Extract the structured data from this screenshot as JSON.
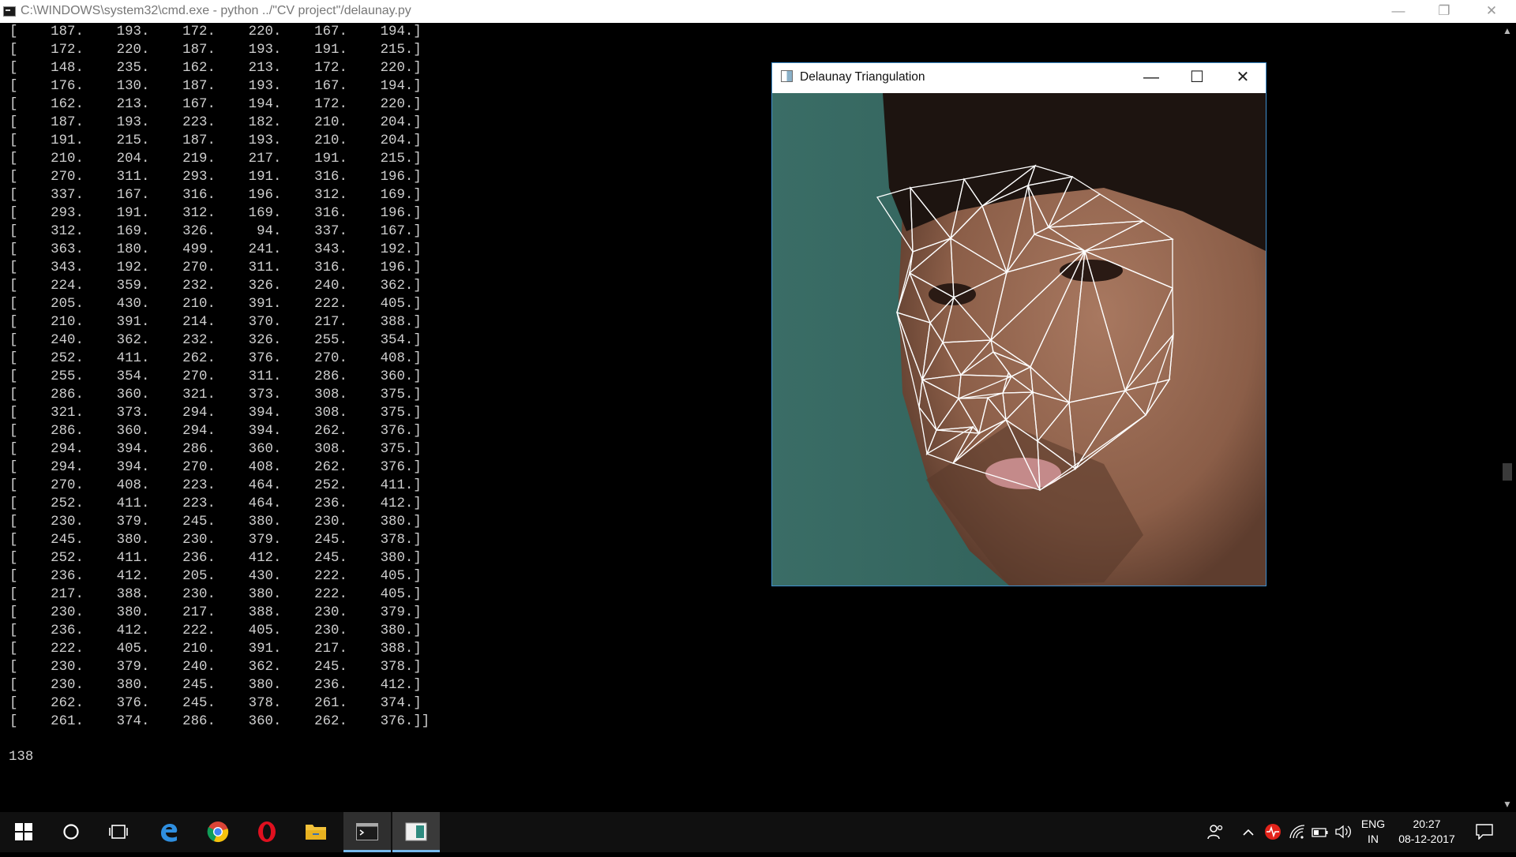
{
  "console": {
    "title": "C:\\WINDOWS\\system32\\cmd.exe - python  ../\"CV project\"/delaunay.py",
    "rows": [
      [
        "187.",
        "193.",
        "172.",
        "220.",
        "167.",
        "194."
      ],
      [
        "172.",
        "220.",
        "187.",
        "193.",
        "191.",
        "215."
      ],
      [
        "148.",
        "235.",
        "162.",
        "213.",
        "172.",
        "220."
      ],
      [
        "176.",
        "130.",
        "187.",
        "193.",
        "167.",
        "194."
      ],
      [
        "162.",
        "213.",
        "167.",
        "194.",
        "172.",
        "220."
      ],
      [
        "187.",
        "193.",
        "223.",
        "182.",
        "210.",
        "204."
      ],
      [
        "191.",
        "215.",
        "187.",
        "193.",
        "210.",
        "204."
      ],
      [
        "210.",
        "204.",
        "219.",
        "217.",
        "191.",
        "215."
      ],
      [
        "270.",
        "311.",
        "293.",
        "191.",
        "316.",
        "196."
      ],
      [
        "337.",
        "167.",
        "316.",
        "196.",
        "312.",
        "169."
      ],
      [
        "293.",
        "191.",
        "312.",
        "169.",
        "316.",
        "196."
      ],
      [
        "312.",
        "169.",
        "326.",
        "94.",
        "337.",
        "167."
      ],
      [
        "363.",
        "180.",
        "499.",
        "241.",
        "343.",
        "192."
      ],
      [
        "343.",
        "192.",
        "270.",
        "311.",
        "316.",
        "196."
      ],
      [
        "224.",
        "359.",
        "232.",
        "326.",
        "240.",
        "362."
      ],
      [
        "205.",
        "430.",
        "210.",
        "391.",
        "222.",
        "405."
      ],
      [
        "210.",
        "391.",
        "214.",
        "370.",
        "217.",
        "388."
      ],
      [
        "240.",
        "362.",
        "232.",
        "326.",
        "255.",
        "354."
      ],
      [
        "252.",
        "411.",
        "262.",
        "376.",
        "270.",
        "408."
      ],
      [
        "255.",
        "354.",
        "270.",
        "311.",
        "286.",
        "360."
      ],
      [
        "286.",
        "360.",
        "321.",
        "373.",
        "308.",
        "375."
      ],
      [
        "321.",
        "373.",
        "294.",
        "394.",
        "308.",
        "375."
      ],
      [
        "286.",
        "360.",
        "294.",
        "394.",
        "262.",
        "376."
      ],
      [
        "294.",
        "394.",
        "286.",
        "360.",
        "308.",
        "375."
      ],
      [
        "294.",
        "394.",
        "270.",
        "408.",
        "262.",
        "376."
      ],
      [
        "270.",
        "408.",
        "223.",
        "464.",
        "252.",
        "411."
      ],
      [
        "252.",
        "411.",
        "223.",
        "464.",
        "236.",
        "412."
      ],
      [
        "230.",
        "379.",
        "245.",
        "380.",
        "230.",
        "380."
      ],
      [
        "245.",
        "380.",
        "230.",
        "379.",
        "245.",
        "378."
      ],
      [
        "252.",
        "411.",
        "236.",
        "412.",
        "245.",
        "380."
      ],
      [
        "236.",
        "412.",
        "205.",
        "430.",
        "222.",
        "405."
      ],
      [
        "217.",
        "388.",
        "230.",
        "380.",
        "222.",
        "405."
      ],
      [
        "230.",
        "380.",
        "217.",
        "388.",
        "230.",
        "379."
      ],
      [
        "236.",
        "412.",
        "222.",
        "405.",
        "230.",
        "380."
      ],
      [
        "222.",
        "405.",
        "210.",
        "391.",
        "217.",
        "388."
      ],
      [
        "230.",
        "379.",
        "240.",
        "362.",
        "245.",
        "378."
      ],
      [
        "230.",
        "380.",
        "245.",
        "380.",
        "236.",
        "412."
      ],
      [
        "262.",
        "376.",
        "245.",
        "378.",
        "261.",
        "374."
      ],
      [
        "261.",
        "374.",
        "286.",
        "360.",
        "262.",
        "376."
      ]
    ],
    "count": "138",
    "minimize_glyph": "—",
    "restore_glyph": "❐",
    "close_glyph": "✕"
  },
  "image_window": {
    "title": "Delaunay Triangulation",
    "minimize_glyph": "—",
    "maximize_glyph": "☐",
    "close_glyph": "✕"
  },
  "taskbar": {
    "keyboard_lang": "ENG",
    "keyboard_region": "IN",
    "time": "20:27",
    "date": "08-12-2017",
    "pinned_apps": [
      "start-icon",
      "cortana-icon",
      "task-view-icon",
      "edge-icon",
      "chrome-icon",
      "opera-icon",
      "file-explorer-icon",
      "cmd-icon",
      "opencv-window-icon"
    ]
  },
  "colors": {
    "console_text": "#cfcfcf",
    "mesh_line": "#ffffff",
    "window_border": "#3f8fd0",
    "taskbar_accent": "#76b9ed"
  }
}
